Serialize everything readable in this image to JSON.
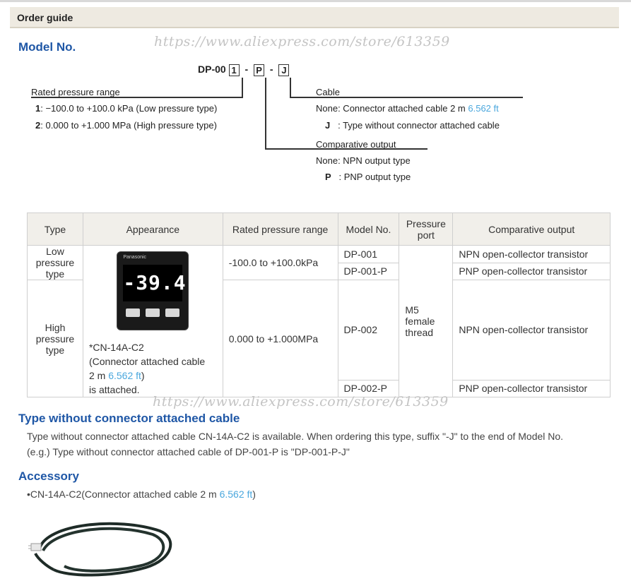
{
  "header": {
    "order_guide": "Order guide"
  },
  "watermark": "https://www.aliexpress.com/store/613359",
  "model_section": {
    "title": "Model No.",
    "prefix": "DP-00",
    "box1": "1",
    "box2": "P",
    "box3": "J",
    "dash": "-",
    "rated_title": "Rated pressure range",
    "rated_1_key": "1",
    "rated_1_text": ": −100.0 to +100.0 kPa (Low pressure type)",
    "rated_2_key": "2",
    "rated_2_text": ": 0.000 to +1.000 MPa (High pressure type)",
    "cable_title": "Cable",
    "cable_none_key": "None",
    "cable_none_text": ": Connector attached cable 2 m",
    "cable_none_ft": "6.562 ft",
    "cable_j_key": "J",
    "cable_j_text": ": Type without connector attached cable",
    "comp_title": "Comparative output",
    "comp_none_key": "None",
    "comp_none_text": ": NPN output type",
    "comp_p_key": "P",
    "comp_p_text": ": PNP output type"
  },
  "table": {
    "headers": {
      "type": "Type",
      "appearance": "Appearance",
      "rated": "Rated pressure range",
      "model": "Model No.",
      "port_l1": "Pressure",
      "port_l2": "port",
      "comp": "Comparative output"
    },
    "low": {
      "l1": "Low",
      "l2": "pressure",
      "l3": "type",
      "range": "-100.0 to +100.0kPa"
    },
    "high": {
      "l1": "High",
      "l2": "pressure",
      "l3": "type",
      "range": "0.000 to +1.000MPa"
    },
    "port": {
      "l1": "M5",
      "l2": "female",
      "l3": "thread"
    },
    "models": [
      "DP-001",
      "DP-001-P",
      "DP-002",
      "DP-002-P"
    ],
    "outputs": [
      "NPN open-collector transistor",
      "PNP open-collector transistor",
      "NPN open-collector transistor",
      "PNP open-collector transistor"
    ],
    "device": {
      "brand": "Panasonic",
      "display": "-39.4"
    },
    "note_l1": "*CN-14A-C2",
    "note_l2": "(Connector attached cable",
    "note_l3_a": "2 m",
    "note_l3_ft": "6.562 ft",
    "note_l3_b": ")",
    "note_l4": "is attached."
  },
  "without_section": {
    "title": "Type without connector attached cable",
    "line1": "Type without connector attached cable CN-14A-C2 is available. When ordering   this type, suffix \"-J\" to the end of Model No.",
    "line2": "(e.g.) Type without connector attached cable of DP-001-P is \"DP-001-P-J\""
  },
  "accessory": {
    "title": "Accessory",
    "item_a": "•CN-14A-C2(Connector attached cable 2 m",
    "item_ft": "6.562 ft",
    "item_b": ")"
  },
  "colors": {
    "title_blue": "#1f57a6",
    "ft_blue": "#4aa7dd",
    "header_bg": "#eeeae1"
  }
}
